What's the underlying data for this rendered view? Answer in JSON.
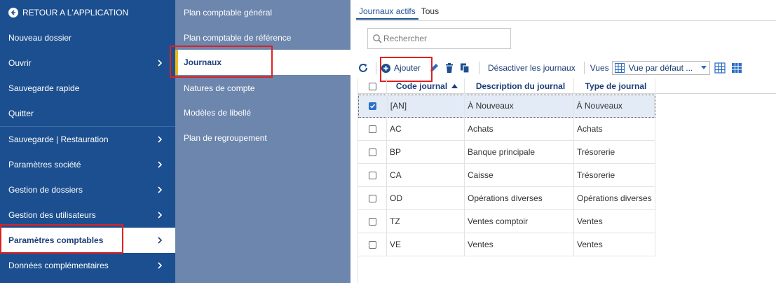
{
  "left_nav": {
    "back_label": "RETOUR A L'APPLICATION",
    "items": [
      {
        "label": "Nouveau dossier"
      },
      {
        "label": "Ouvrir"
      },
      {
        "label": "Sauvegarde rapide"
      },
      {
        "label": "Quitter"
      },
      {
        "label": "Sauvegarde | Restauration"
      },
      {
        "label": "Paramètres société"
      },
      {
        "label": "Gestion de dossiers"
      },
      {
        "label": "Gestion des utilisateurs"
      },
      {
        "label": "Paramètres comptables"
      },
      {
        "label": "Données complémentaires"
      }
    ]
  },
  "sub_nav": {
    "items": [
      {
        "label": "Plan comptable général"
      },
      {
        "label": "Plan comptable de référence"
      },
      {
        "label": "Journaux"
      },
      {
        "label": "Natures de compte"
      },
      {
        "label": "Modèles de libellé"
      },
      {
        "label": "Plan de regroupement"
      }
    ]
  },
  "tabs": [
    {
      "label": "Journaux actifs",
      "active": true
    },
    {
      "label": "Tous",
      "active": false
    }
  ],
  "search": {
    "placeholder": "Rechercher"
  },
  "toolbar": {
    "add_label": "Ajouter",
    "deactivate_label": "Désactiver les journaux",
    "views_label": "Vues",
    "view_select_value": "Vue par défaut ..."
  },
  "table": {
    "columns": [
      "Code journal",
      "Description du journal",
      "Type de journal"
    ],
    "rows": [
      {
        "code": "[AN]",
        "description": "À Nouveaux",
        "type": "À Nouveaux",
        "checked": true
      },
      {
        "code": "AC",
        "description": "Achats",
        "type": "Achats",
        "checked": false
      },
      {
        "code": "BP",
        "description": "Banque principale",
        "type": "Trésorerie",
        "checked": false
      },
      {
        "code": "CA",
        "description": "Caisse",
        "type": "Trésorerie",
        "checked": false
      },
      {
        "code": "OD",
        "description": "Opérations diverses",
        "type": "Opérations diverses",
        "checked": false
      },
      {
        "code": "TZ",
        "description": "Ventes comptoir",
        "type": "Ventes",
        "checked": false
      },
      {
        "code": "VE",
        "description": "Ventes",
        "type": "Ventes",
        "checked": false
      }
    ]
  },
  "colors": {
    "nav_blue": "#1c4f8f",
    "subnav_blue": "#6c86ad",
    "accent_yellow": "#f2b61c",
    "highlight_red": "#e02020"
  }
}
